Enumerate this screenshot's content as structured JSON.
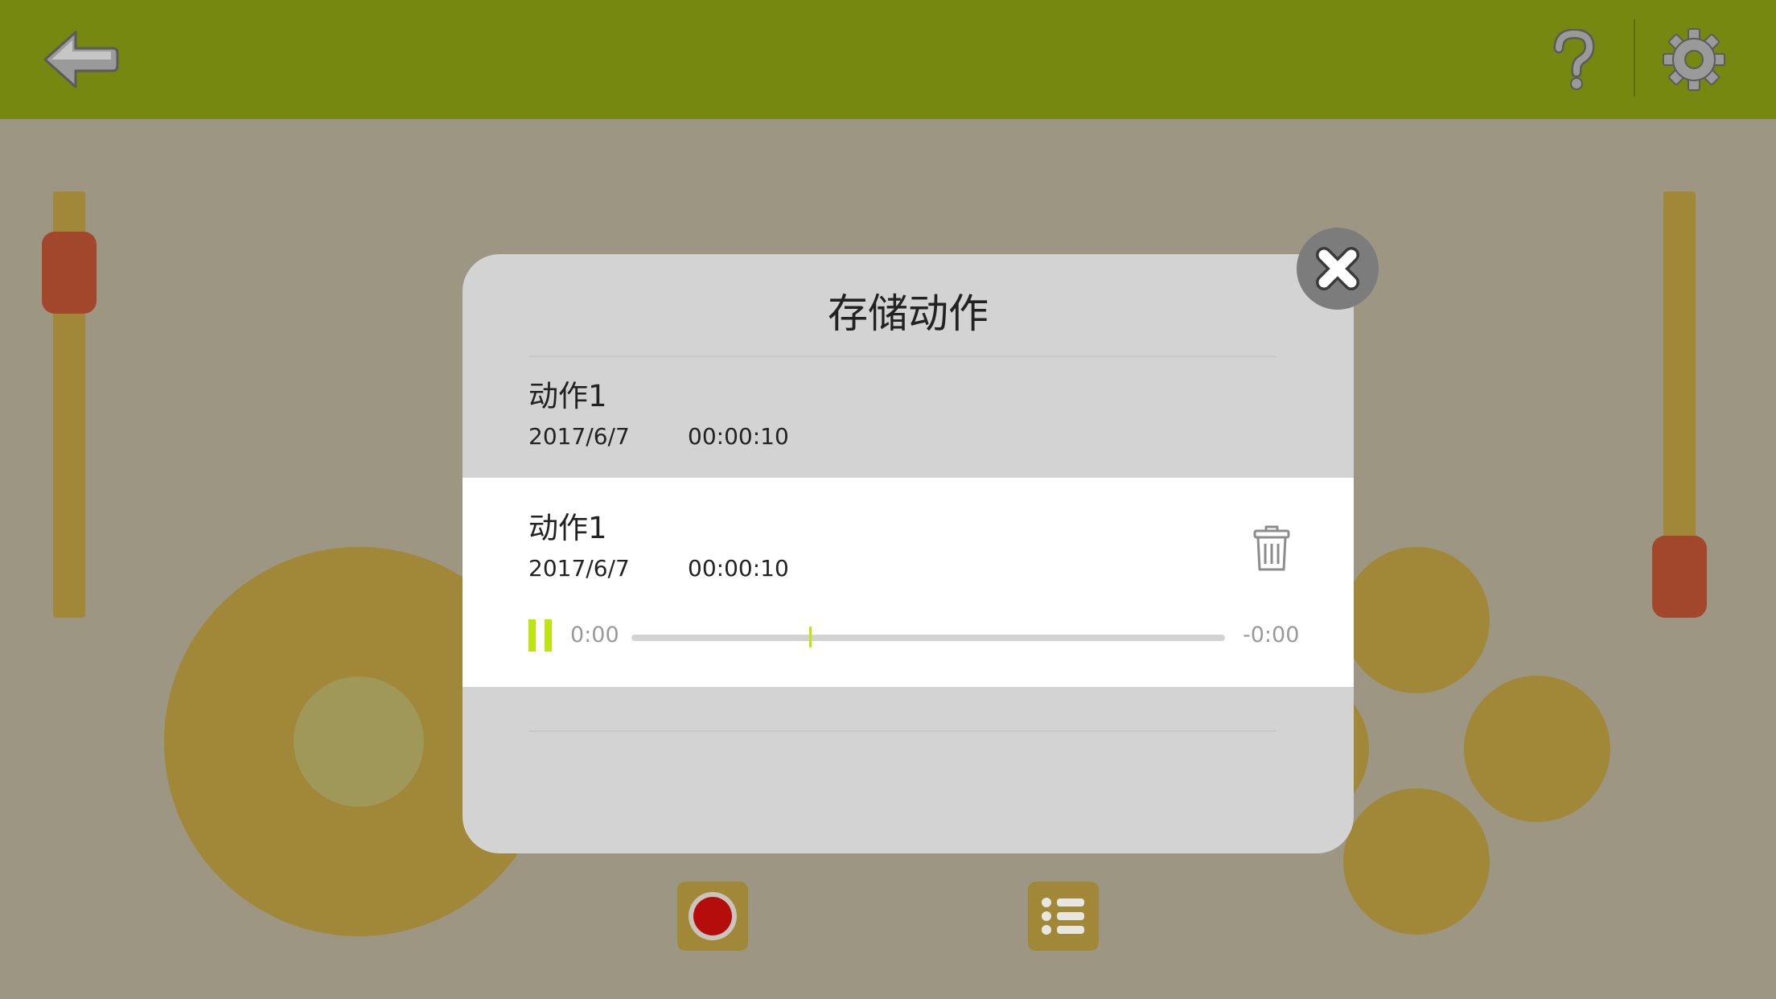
{
  "colors": {
    "topbar": "#76880f",
    "background": "#9d9683",
    "control": "#a08838",
    "thumb": "#a3472c",
    "accent": "#bde50f",
    "record": "#b40d0c"
  },
  "header": {
    "back_icon": "back-arrow-icon",
    "help_icon": "help-icon",
    "settings_icon": "gear-icon"
  },
  "sliders": {
    "left_level": 0.92,
    "right_level": 0.09
  },
  "bottom_toolbar": {
    "record_icon": "record-icon",
    "list_icon": "list-icon"
  },
  "modal": {
    "title": "存储动作",
    "close_icon": "close-icon",
    "items": [
      {
        "name": "动作1",
        "date": "2017/6/7",
        "duration": "00:00:10"
      },
      {
        "name": "动作1",
        "date": "2017/6/7",
        "duration": "00:00:10",
        "selected": true,
        "delete_icon": "trash-icon",
        "player": {
          "pause_icon": "pause-icon",
          "elapsed": "0:00",
          "remaining": "-0:00",
          "progress": 0.3
        }
      }
    ]
  }
}
